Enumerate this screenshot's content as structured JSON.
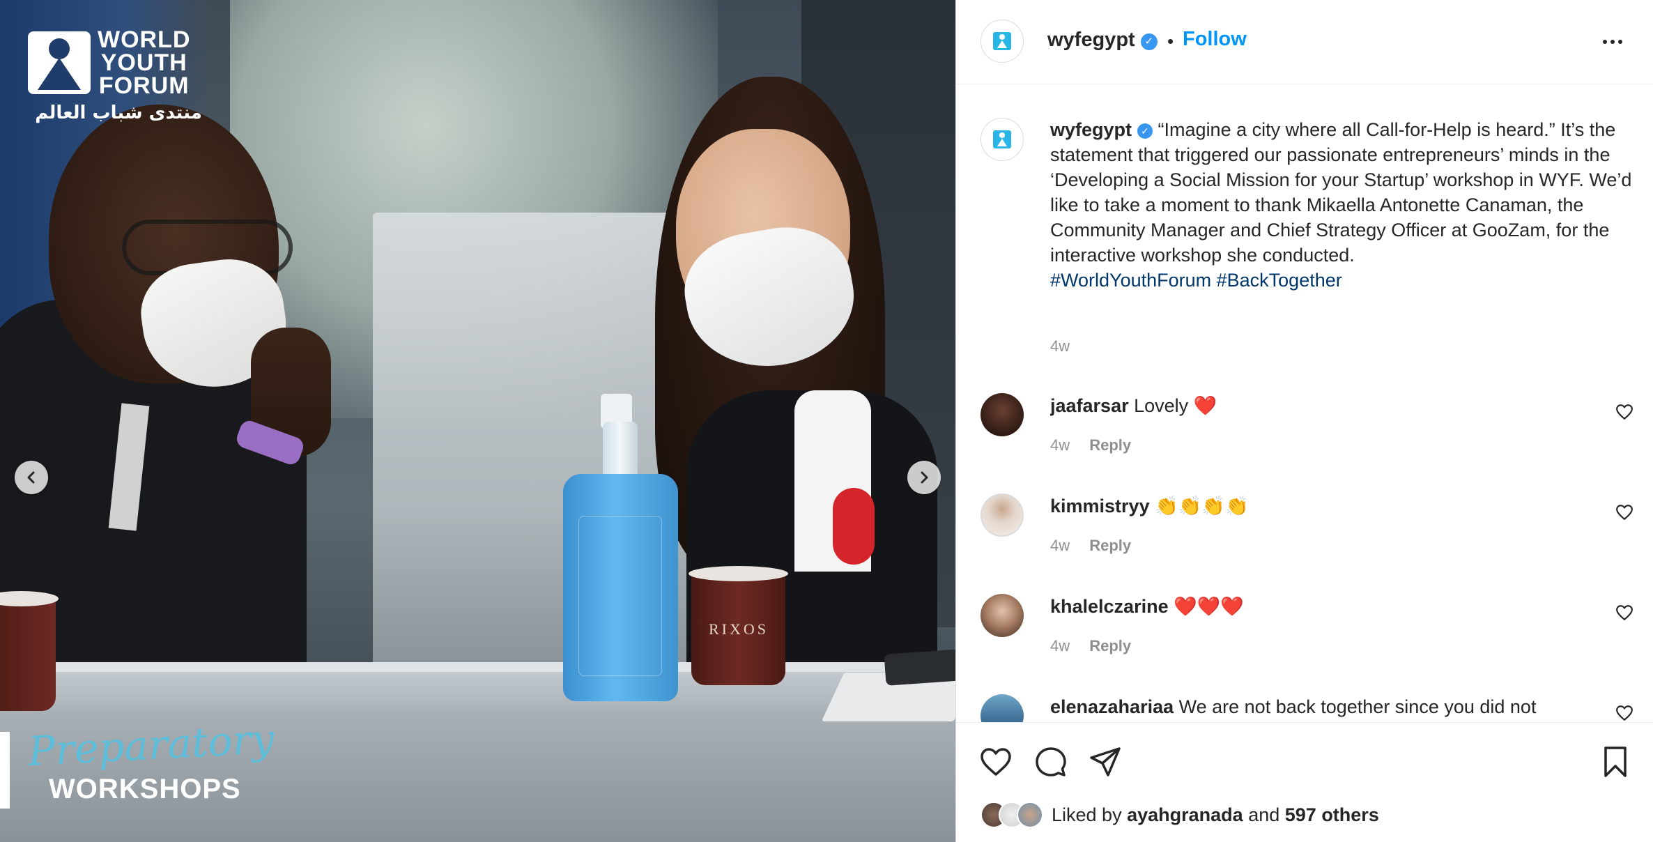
{
  "post": {
    "image": {
      "logo_lines": [
        "WORLD",
        "YOUTH",
        "FORUM"
      ],
      "logo_arabic": "منتدى شباب العالم",
      "banner_script": "Preparatory",
      "banner_title": "WORKSHOPS",
      "cup_brand": "RIXOS"
    }
  },
  "header": {
    "username": "wyfegypt",
    "verified": true,
    "separator": "•",
    "follow_label": "Follow"
  },
  "caption": {
    "username": "wyfegypt",
    "text": "“Imagine a city where all Call-for-Help is heard.” It’s the statement that triggered our passionate entrepreneurs’ minds in the ‘Developing a Social Mission for your Startup’ workshop in WYF. We’d like to take a moment to thank Mikaella Antonette Canaman, the Community Manager and Chief Strategy Officer at GooZam, for the interactive workshop she conducted.",
    "hashtags": "#WorldYouthForum #BackTogether",
    "time": "4w"
  },
  "comments": [
    {
      "username": "jaafarsar",
      "text": "Lovely ❤️",
      "time": "4w",
      "reply_label": "Reply"
    },
    {
      "username": "kimmistryy",
      "text": "👏👏👏👏",
      "time": "4w",
      "reply_label": "Reply"
    },
    {
      "username": "khalelczarine",
      "text": "❤️❤️❤️",
      "time": "4w",
      "reply_label": "Reply"
    },
    {
      "username": "elenazahariaa",
      "text": "We are not back together since you did not",
      "time": "",
      "reply_label": ""
    }
  ],
  "likes": {
    "prefix": "Liked by",
    "user": "ayahgranada",
    "joiner": "and",
    "others": "597 others"
  },
  "colors": {
    "accent": "#0095f6",
    "verified": "#3897f0",
    "hashtag": "#00376b",
    "muted": "#8e8e8e"
  }
}
